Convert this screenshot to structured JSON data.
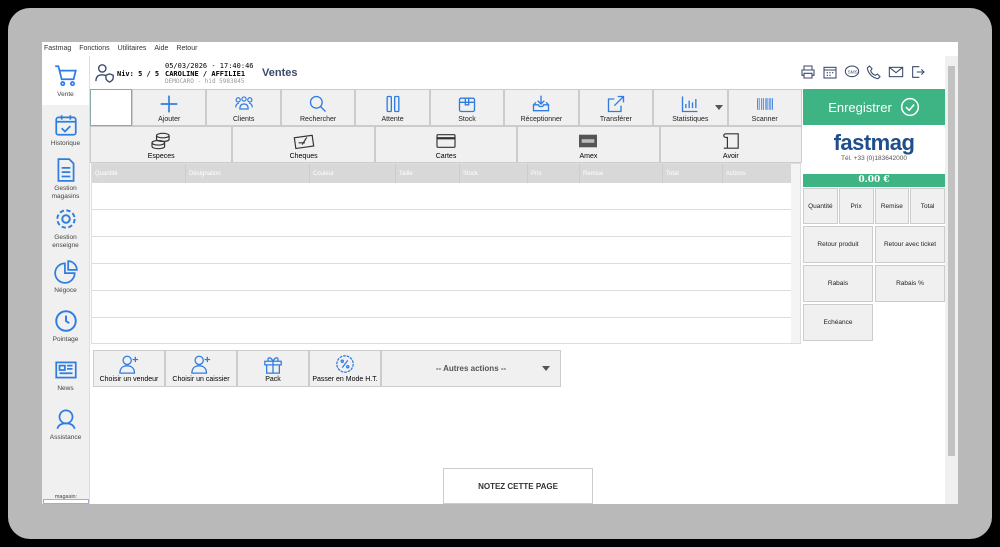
{
  "menu": [
    "Fastmag",
    "Fonctions",
    "Utilitaires",
    "Aide",
    "Retour"
  ],
  "sidebar": {
    "items": [
      {
        "label": "Vente",
        "icon": "cart-icon"
      },
      {
        "label": "Historique",
        "icon": "calendar-check-icon"
      },
      {
        "label": "Gestion magasins",
        "icon": "document-icon"
      },
      {
        "label": "Gestion enseigne",
        "icon": "gear-icon"
      },
      {
        "label": "Négoce",
        "icon": "pie-chart-icon"
      },
      {
        "label": "Pointage",
        "icon": "clock-icon"
      },
      {
        "label": "News",
        "icon": "newspaper-icon"
      },
      {
        "label": "Assistance",
        "icon": "headset-icon"
      }
    ],
    "magasin_label": "magasin:"
  },
  "header": {
    "niv": "Niv: 5 / 5",
    "datetime": "05/03/2026 - 17:40:46",
    "user": "CAROLINE / AFFILIE1",
    "sub": "DEMOCARO - hid 5983845",
    "title": "Ventes"
  },
  "toolbar": [
    "Ajouter",
    "Clients",
    "Rechercher",
    "Attente",
    "Stock",
    "Réceptionner",
    "Transférer",
    "Statistiques",
    "Scanner"
  ],
  "payments": [
    "Especes",
    "Cheques",
    "Cartes",
    "Amex",
    "Avoir"
  ],
  "table": {
    "columns": [
      "Quantité",
      "Désignation",
      "Couleur",
      "Taille",
      "Stock",
      "Prix",
      "Remise",
      "Total",
      "Actions"
    ]
  },
  "actions": [
    "Choisir un vendeur",
    "Choisir un caissier",
    "Pack",
    "Passer en Mode H.T."
  ],
  "autres_actions": "-- Autres actions --",
  "note": "NOTEZ CETTE PAGE",
  "right": {
    "save": "Enregistrer",
    "logo": "fastmag",
    "tel": "Tél. +33 (0)183642000",
    "total": "0.00 €",
    "cols": [
      "Quantité",
      "Prix",
      "Remise",
      "Total"
    ],
    "buttons": [
      "Retour produit",
      "Retour avec ticket",
      "Rabais",
      "Rabais %",
      "Echéance"
    ]
  },
  "colors": {
    "accent": "#3eb383",
    "icon": "#2f7de1",
    "brand": "#1f4e8c"
  }
}
